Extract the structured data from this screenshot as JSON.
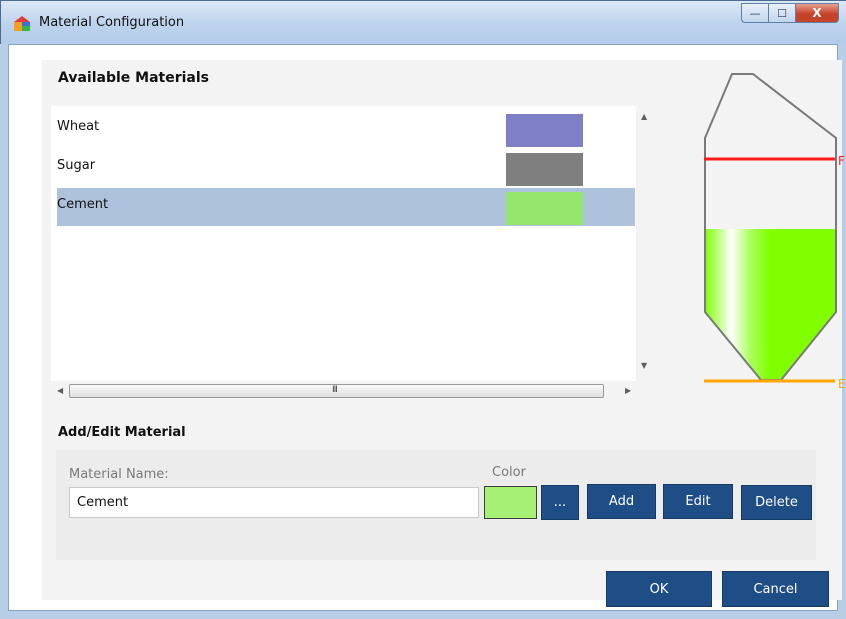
{
  "window": {
    "title": "Material Configuration",
    "minimize": "—",
    "maximize": "☐",
    "close": "X"
  },
  "materials_section": {
    "title": "Available Materials"
  },
  "materials": [
    {
      "name": "Wheat",
      "color": "#7f7fc8"
    },
    {
      "name": "Sugar",
      "color": "#7f7f7f"
    },
    {
      "name": "Cement",
      "color": "#96e66e"
    }
  ],
  "selected_index": 2,
  "scrollbar": {
    "grip": "III",
    "up": "▲",
    "down": "▼",
    "left": "◀",
    "right": "▶"
  },
  "edit_section": {
    "title": "Add/Edit Material",
    "name_label": "Material Name:",
    "name_value": "Cement",
    "color_label": "Color",
    "color_value": "#a6f076",
    "browse_label": "...",
    "add_label": "Add",
    "edit_label": "Edit",
    "delete_label": "Delete"
  },
  "footer": {
    "ok_label": "OK",
    "cancel_label": "Cancel"
  },
  "silo_preview": {
    "full_marker": "F",
    "empty_marker": "E",
    "fill_color": "#80ff00",
    "full_line_color": "#ff1a1a",
    "empty_line_color": "#ffa500"
  }
}
